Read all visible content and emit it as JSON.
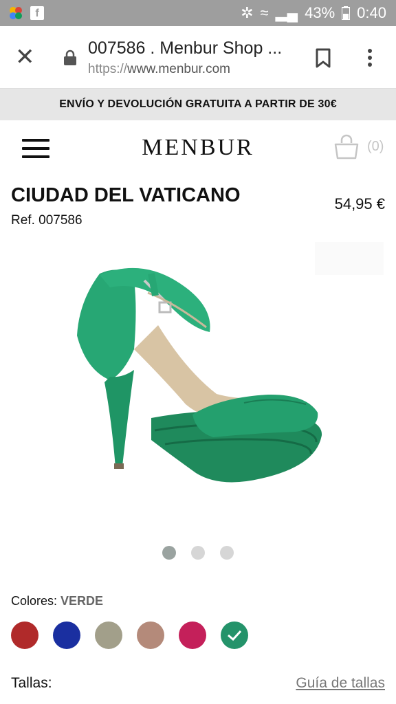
{
  "status_bar": {
    "battery": "43%",
    "time": "0:40"
  },
  "browser": {
    "tab_title": "007586 . Menbur Shop ...",
    "url_proto": "https://",
    "url_host": "www.menbur.com"
  },
  "promo": {
    "text": "ENVÍO Y DEVOLUCIÓN GRATUITA A PARTIR DE 30€"
  },
  "header": {
    "logo": "MENBUR",
    "cart_count": "(0)"
  },
  "product": {
    "name": "CIUDAD DEL VATICANO",
    "ref": "Ref. 007586",
    "price": "54,95 €",
    "image_icon": "green-peep-toe-sandal"
  },
  "gallery": {
    "count": 3,
    "active": 0
  },
  "colors": {
    "label": "Colores:",
    "selected": "VERDE",
    "swatches": [
      "#b02a2a",
      "#1a2fa0",
      "#a29f8a",
      "#b48a7a",
      "#c4205a",
      "#24936a"
    ],
    "selected_index": 5
  },
  "sizes": {
    "label": "Tallas:",
    "guide_link": "Guía de tallas"
  }
}
